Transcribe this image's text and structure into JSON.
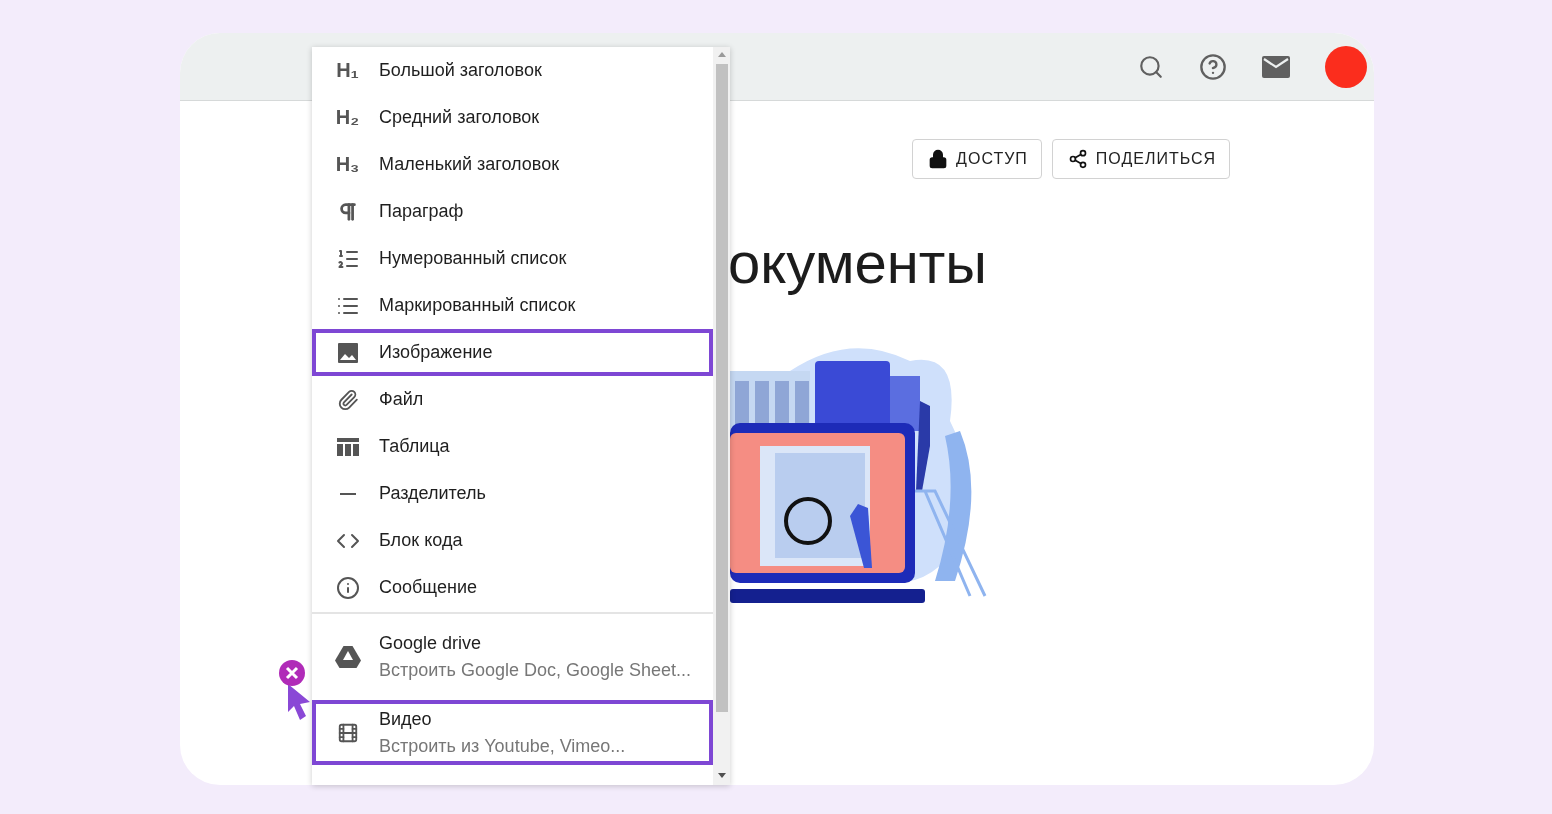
{
  "header": {
    "avatar": {
      "color": "#fb2d1d"
    }
  },
  "actions": [
    {
      "label": "ДОСТУП",
      "kind": "lock"
    },
    {
      "label": "ПОДЕЛИТЬСЯ",
      "kind": "share"
    }
  ],
  "title": "окументы",
  "menu": {
    "items": [
      {
        "kind": "heading",
        "icon_text": "H₁",
        "label": "Большой заголовок",
        "highlighted": false
      },
      {
        "kind": "heading",
        "icon_text": "H₂",
        "label": "Средний заголовок",
        "highlighted": false
      },
      {
        "kind": "heading",
        "icon_text": "H₃",
        "label": "Маленький заголовок",
        "highlighted": false
      },
      {
        "kind": "pilcrow",
        "label": "Параграф",
        "highlighted": false
      },
      {
        "kind": "numbered",
        "label": "Нумерованный список",
        "highlighted": false
      },
      {
        "kind": "bulleted",
        "label": "Маркированный список",
        "highlighted": false
      },
      {
        "kind": "image",
        "label": "Изображение",
        "highlighted": true
      },
      {
        "kind": "file",
        "label": "Файл",
        "highlighted": false
      },
      {
        "kind": "table",
        "label": "Таблица",
        "highlighted": false
      },
      {
        "kind": "divider",
        "label": "Разделитель",
        "highlighted": false
      },
      {
        "kind": "code",
        "label": "Блок кода",
        "highlighted": false
      },
      {
        "kind": "info",
        "label": "Сообщение",
        "highlighted": false
      }
    ],
    "embeds": [
      {
        "kind": "drive",
        "label": "Google drive",
        "description": "Встроить Google Doc, Google Sheet...",
        "highlighted": false
      },
      {
        "kind": "video",
        "label": "Видео",
        "description": "Встроить из Youtube, Vimeo...",
        "highlighted": true
      }
    ]
  }
}
